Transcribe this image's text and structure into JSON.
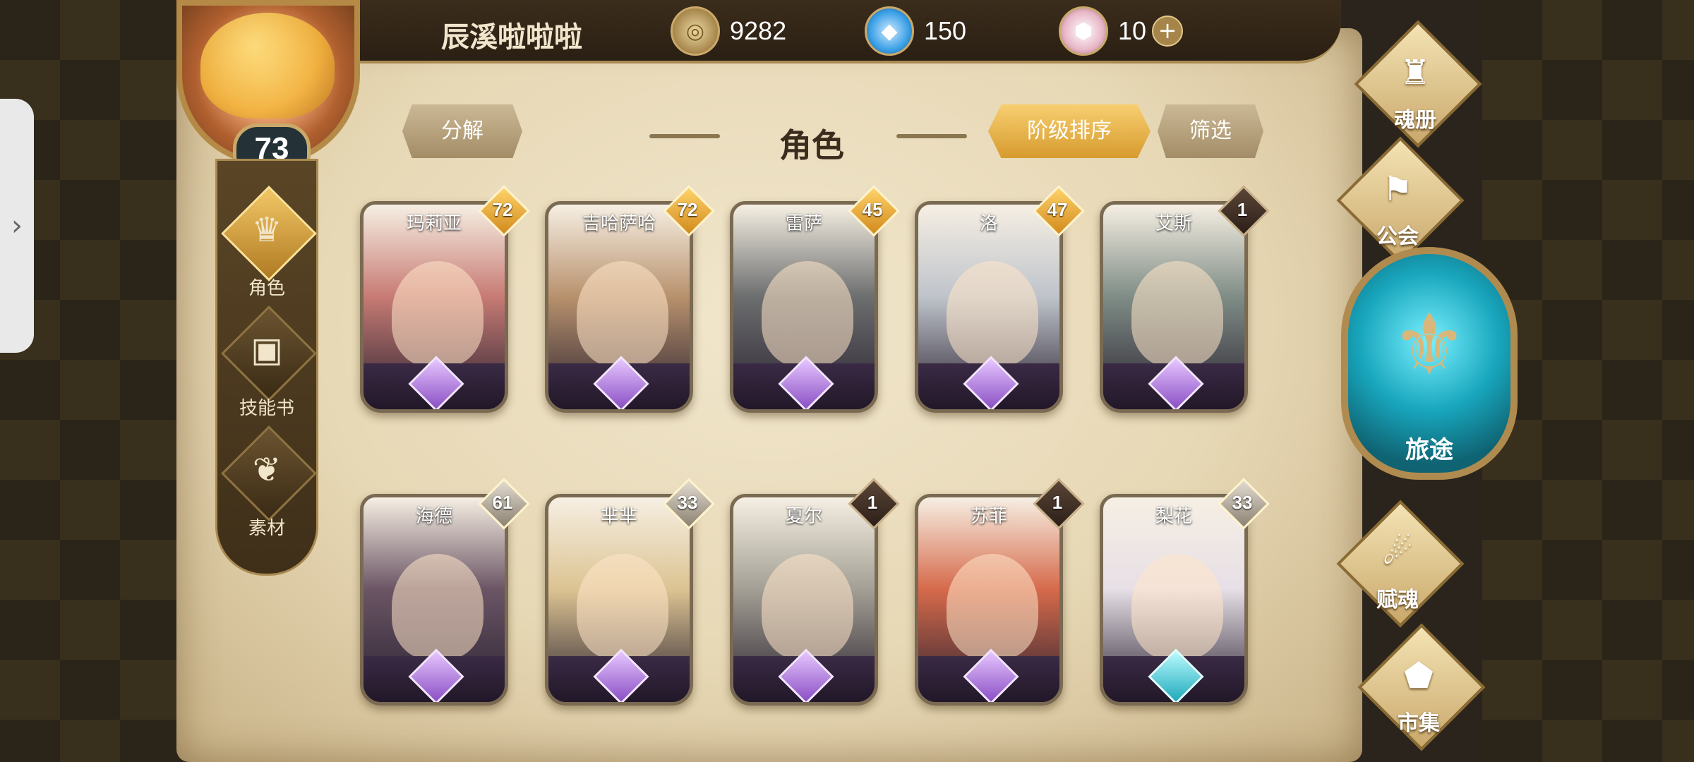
{
  "player": {
    "name": "辰溪啦啦啦",
    "level": "73"
  },
  "resources": [
    {
      "icon": "coin-icon",
      "value": "9282",
      "color": "#caa96a"
    },
    {
      "icon": "crystal-icon",
      "value": "150",
      "color": "#3aa0e6"
    },
    {
      "icon": "gem-icon",
      "value": "10",
      "color": "#e8b7c7"
    }
  ],
  "left_nav": [
    {
      "label": "角色",
      "icon": "character-icon",
      "active": true
    },
    {
      "label": "技能书",
      "icon": "skillbook-icon",
      "active": false
    },
    {
      "label": "素材",
      "icon": "material-icon",
      "active": false
    }
  ],
  "header": {
    "decompose": "分解",
    "title": "角色",
    "sort": "阶级排序",
    "filter": "筛选"
  },
  "cards": [
    {
      "name": "玛莉亚",
      "level": "72",
      "badge": "gold",
      "bg": "#c77b74"
    },
    {
      "name": "吉哈萨哈",
      "level": "72",
      "badge": "gold",
      "bg": "#b8916d"
    },
    {
      "name": "雷萨",
      "level": "45",
      "badge": "gold",
      "bg": "#6c6e6f"
    },
    {
      "name": "洛",
      "level": "47",
      "badge": "gold",
      "bg": "#bfc4cb"
    },
    {
      "name": "艾斯",
      "level": "1",
      "badge": "dark",
      "bg": "#7f8d86"
    },
    {
      "name": "海德",
      "level": "61",
      "badge": "silver",
      "bg": "#6b5565"
    },
    {
      "name": "芈芈",
      "level": "33",
      "badge": "silver",
      "bg": "#dcc392"
    },
    {
      "name": "夏尔",
      "level": "1",
      "badge": "dark",
      "bg": "#a39f94"
    },
    {
      "name": "苏菲",
      "level": "1",
      "badge": "dark",
      "bg": "#d66a4b"
    },
    {
      "name": "梨花",
      "level": "33",
      "badge": "silver",
      "bg": "#e7dfe6"
    }
  ],
  "right_menu": {
    "soul": "魂册",
    "guild": "公会",
    "journey": "旅途",
    "endow": "赋魂",
    "market": "市集"
  }
}
